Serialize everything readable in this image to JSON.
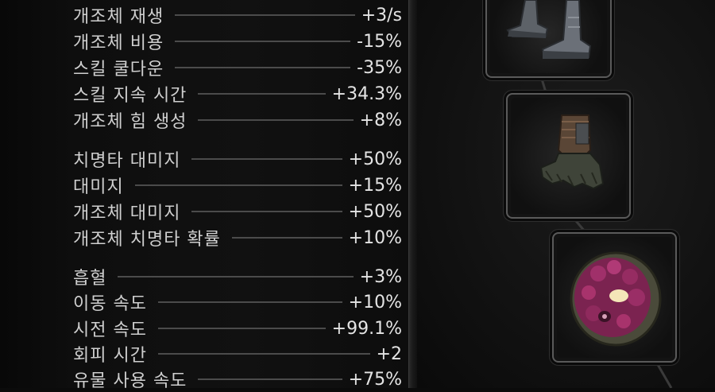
{
  "stats": {
    "group1": [
      {
        "name": "개조체 재생",
        "value": "+3/s"
      },
      {
        "name": "개조체 비용",
        "value": "-15%"
      },
      {
        "name": "스킬 쿨다운",
        "value": "-35%"
      },
      {
        "name": "스킬 지속 시간",
        "value": "+34.3%"
      },
      {
        "name": "개조체 힘 생성",
        "value": "+8%"
      }
    ],
    "group2": [
      {
        "name": "치명타 대미지",
        "value": "+50%"
      },
      {
        "name": "대미지",
        "value": "+15%"
      },
      {
        "name": "개조체 대미지",
        "value": "+50%"
      },
      {
        "name": "개조체 치명타 확률",
        "value": "+10%"
      }
    ],
    "group3": [
      {
        "name": "흡혈",
        "value": "+3%"
      },
      {
        "name": "이동 속도",
        "value": "+10%"
      },
      {
        "name": "시전 속도",
        "value": "+99.1%"
      },
      {
        "name": "회피 시간",
        "value": "+2"
      },
      {
        "name": "유물 사용 속도",
        "value": "+75%"
      }
    ]
  },
  "equipment": [
    {
      "slot": "boots",
      "icon": "boots-icon"
    },
    {
      "slot": "gloves",
      "icon": "gloves-icon"
    },
    {
      "slot": "relic",
      "icon": "relic-orb-icon"
    }
  ],
  "colors": {
    "text": "#cfcfcf",
    "line": "#4b4b4b",
    "slot_border": "#5a5a5a",
    "relic": "#a0306a"
  }
}
